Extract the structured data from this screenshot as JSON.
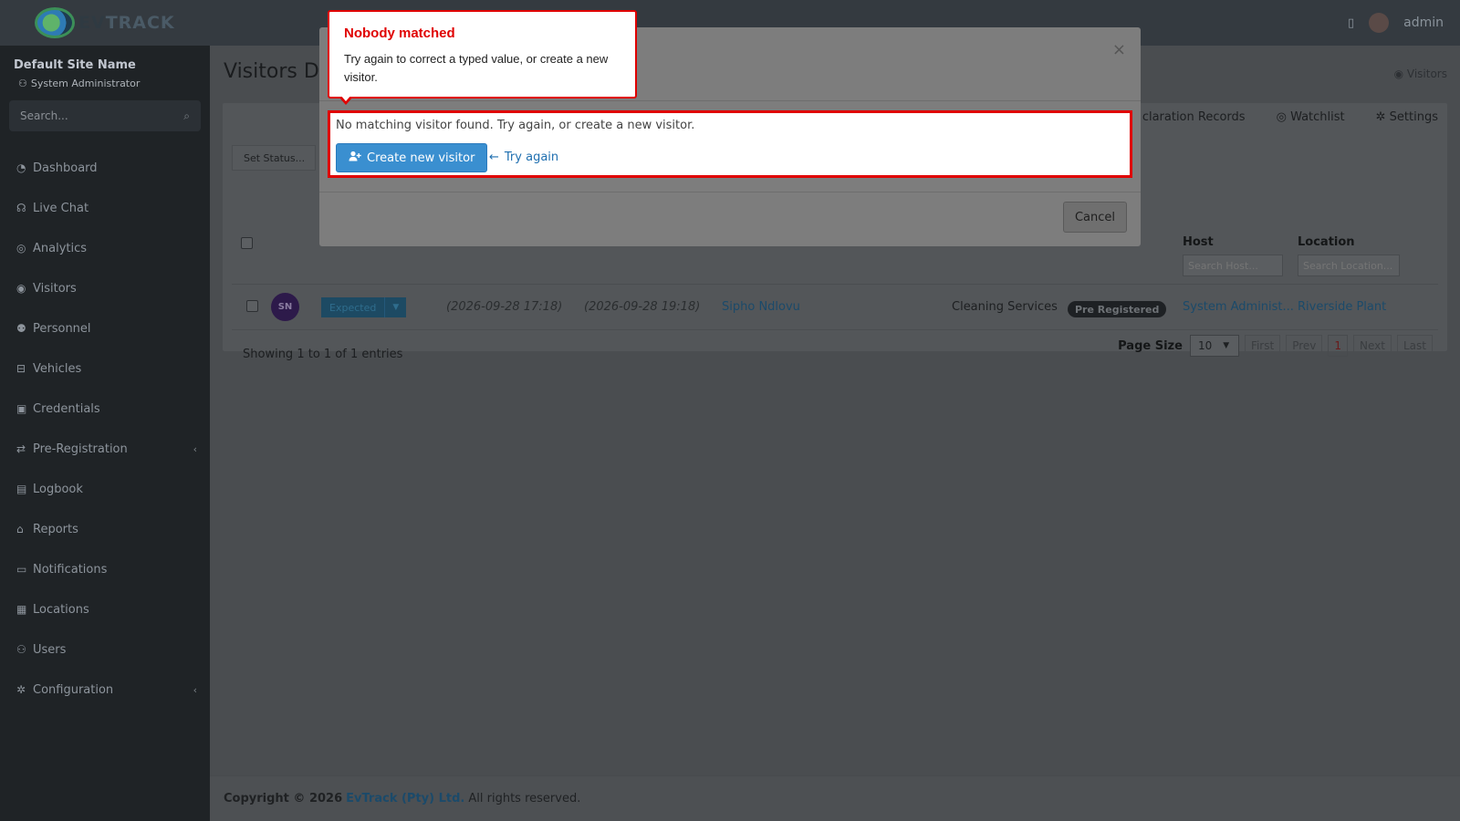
{
  "brand": {
    "name_bold": "EV",
    "name_rest": "TRACK"
  },
  "topbar": {
    "username": "admin"
  },
  "sidebar": {
    "site_name": "Default Site Name",
    "role": "System Administrator",
    "search_placeholder": "Search...",
    "items": [
      {
        "label": "Dashboard",
        "icon": "dashboard-icon"
      },
      {
        "label": "Live Chat",
        "icon": "headset-icon"
      },
      {
        "label": "Analytics",
        "icon": "chart-icon"
      },
      {
        "label": "Visitors",
        "icon": "eye-icon"
      },
      {
        "label": "Personnel",
        "icon": "users-icon"
      },
      {
        "label": "Vehicles",
        "icon": "car-icon"
      },
      {
        "label": "Credentials",
        "icon": "id-card-icon"
      },
      {
        "label": "Pre-Registration",
        "icon": "exchange-icon"
      },
      {
        "label": "Logbook",
        "icon": "book-icon"
      },
      {
        "label": "Reports",
        "icon": "report-icon"
      },
      {
        "label": "Notifications",
        "icon": "bell-icon"
      },
      {
        "label": "Locations",
        "icon": "building-icon"
      },
      {
        "label": "Users",
        "icon": "user-cog-icon"
      },
      {
        "label": "Configuration",
        "icon": "gear-icon"
      }
    ]
  },
  "page": {
    "title": "Visitors Da",
    "breadcrumb": "Visitors",
    "tabs": [
      "claration Records",
      "Watchlist",
      "Settings"
    ],
    "set_status": "Set Status...",
    "headers": {
      "host": "Host",
      "location": "Location"
    },
    "host_placeholder": "Search Host...",
    "location_placeholder": "Search Location...",
    "row": {
      "initials": "SN",
      "status": "Expected",
      "start": "(2026-09-28 17:18)",
      "end": "(2026-09-28 19:18)",
      "name": "Sipho Ndlovu",
      "company": "Cleaning Services",
      "badge": "Pre Registered",
      "host": "System Administ...",
      "location": "Riverside Plant"
    },
    "showing": "Showing 1 to 1 of 1 entries",
    "page_size_label": "Page Size",
    "page_size": "10",
    "pager": {
      "first": "First",
      "prev": "Prev",
      "current": "1",
      "next": "Next",
      "last": "Last"
    }
  },
  "modal": {
    "close": "×",
    "message": "No matching visitor found. Try again, or create a new visitor.",
    "create_button": "Create new visitor",
    "try_again": "Try again",
    "cancel": "Cancel"
  },
  "tooltip": {
    "title": "Nobody matched",
    "body": "Try again to correct a typed value, or create a new visitor."
  },
  "footer": {
    "copyright": "Copyright © 2026",
    "company": "EvTrack (Pty) Ltd.",
    "rights": "All rights reserved."
  }
}
